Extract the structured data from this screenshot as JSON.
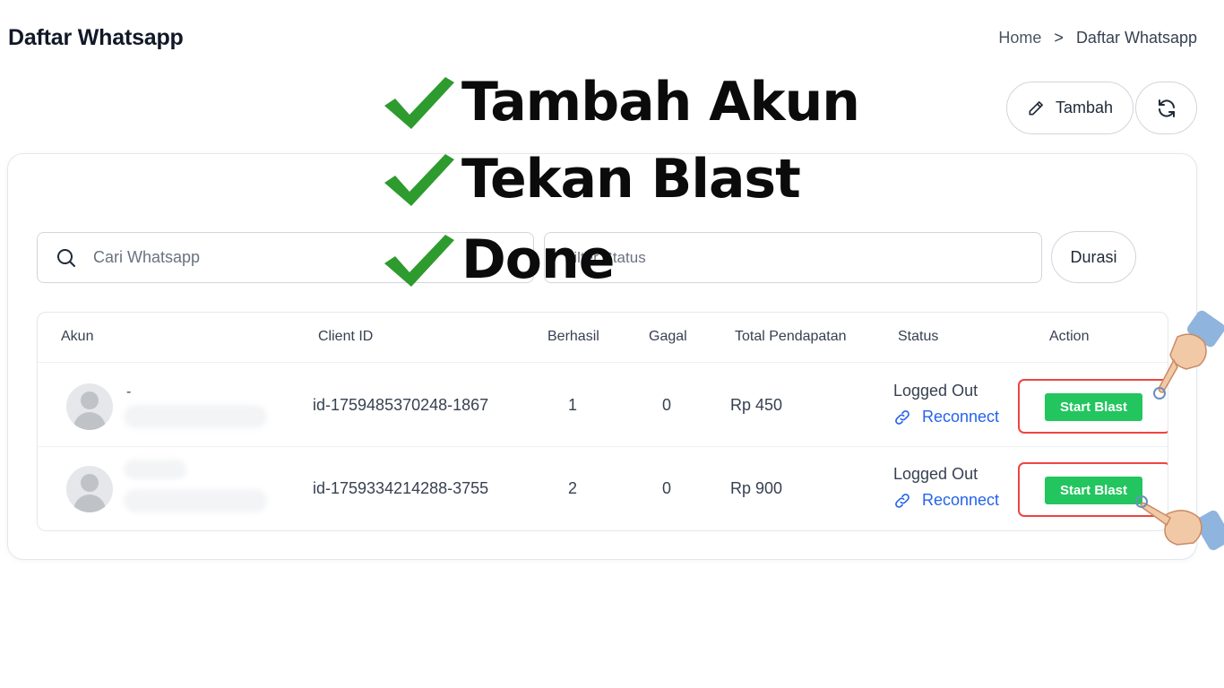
{
  "header": {
    "page_title": "Daftar Whatsapp",
    "breadcrumb": {
      "home": "Home",
      "separator": ">",
      "current": "Daftar Whatsapp"
    }
  },
  "actions": {
    "add_label": "Tambah",
    "add_icon": "pencil-icon",
    "refresh_icon": "refresh-icon"
  },
  "filters": {
    "search_placeholder": "Cari Whatsapp",
    "status_placeholder": "Filter Status",
    "duration_label": "Durasi"
  },
  "table": {
    "columns": [
      "Akun",
      "Client ID",
      "Berhasil",
      "Gagal",
      "Total Pendapatan",
      "Status",
      "Action"
    ],
    "rows": [
      {
        "akun": "-",
        "client_id": "id-1759485370248-1867",
        "berhasil": "1",
        "gagal": "0",
        "pendapatan": "Rp 450",
        "status": "Logged Out",
        "reconnect": "Reconnect",
        "action": "Start Blast"
      },
      {
        "akun": "",
        "client_id": "id-1759334214288-3755",
        "berhasil": "2",
        "gagal": "0",
        "pendapatan": "Rp 900",
        "status": "Logged Out",
        "reconnect": "Reconnect",
        "action": "Start Blast"
      }
    ]
  },
  "overlay": {
    "steps": [
      "Tambah Akun",
      "Tekan Blast",
      "Done"
    ],
    "check_color": "#2e9b2e"
  },
  "colors": {
    "accent_green": "#22c55e",
    "link_blue": "#2563eb",
    "highlight_red": "#ef4444"
  }
}
